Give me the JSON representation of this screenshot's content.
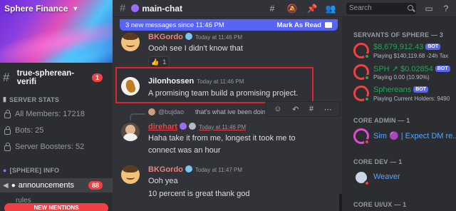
{
  "server": {
    "name": "Sphere Finance",
    "channels": [
      {
        "label": "true-spherean-verifi",
        "badge": "1"
      }
    ],
    "stats_category": "SERVER STATS",
    "stats": [
      {
        "label": "All Members: 17218"
      },
      {
        "label": "Bots: 25"
      },
      {
        "label": "Server Boosters: 52"
      }
    ],
    "info_category": "[SPHERE] INFO",
    "announcements": {
      "label": "announcements",
      "badge": "88"
    },
    "rules_label": "rules",
    "new_mentions": "NEW MENTIONS"
  },
  "channel": {
    "name": "main-chat",
    "header_icons": [
      "threads-icon",
      "mute-icon",
      "pin-icon",
      "members-icon"
    ]
  },
  "search": {
    "placeholder": "Search"
  },
  "new_messages_bar": {
    "text": "3 new messages since 11:46 PM",
    "action": "Mark As Read"
  },
  "messages": [
    {
      "author": "BKGordo",
      "time": "Today at 11:46 PM",
      "lines": [
        "Oooh see I didn't know that"
      ],
      "reaction": {
        "emoji": "👍",
        "count": "1"
      }
    },
    {
      "author": "Jilonhossen",
      "time": "Today at 11:46 PM",
      "lines": [
        "A promising team build a promising project."
      ]
    },
    {
      "reply": {
        "name": "@bujdao",
        "text": "that's what ive been doing fo"
      },
      "author": "direhart",
      "time": "Today at 11:46 PM",
      "lines": [
        "Haha take it from me, longest it took me to",
        "connect was an hour"
      ]
    },
    {
      "author": "BKGordo",
      "time": "Today at 11:47 PM",
      "lines": [
        "Ooh yea",
        "10 percent is great thank god"
      ]
    }
  ],
  "members_list": {
    "groups": [
      {
        "title": "SERVANTS OF SPHERE — 3",
        "members": [
          {
            "name": "$8,679,912.43",
            "bot": "BOT",
            "activity": "Playing $140,119.68 -24h Tax"
          },
          {
            "name": "SPH ↗ $0.02854",
            "bot": "BOT",
            "activity": "Playing 0.00 (10.90%)"
          },
          {
            "name": "Sphereans",
            "bot": "BOT",
            "activity": "Playing Current Holders: 9490"
          }
        ]
      },
      {
        "title": "CORE ADMIN — 1",
        "members": [
          {
            "name": "Sim 🟣 | Expect DM re..."
          }
        ]
      },
      {
        "title": "CORE DEV — 1",
        "members": [
          {
            "name": "Weaver"
          }
        ]
      },
      {
        "title": "CORE UI/UX — 1",
        "members": []
      }
    ]
  },
  "colors": {
    "accent": "#5865f2",
    "danger": "#f23f43",
    "online": "#23a55a",
    "highlight_border": "#e0242b"
  }
}
